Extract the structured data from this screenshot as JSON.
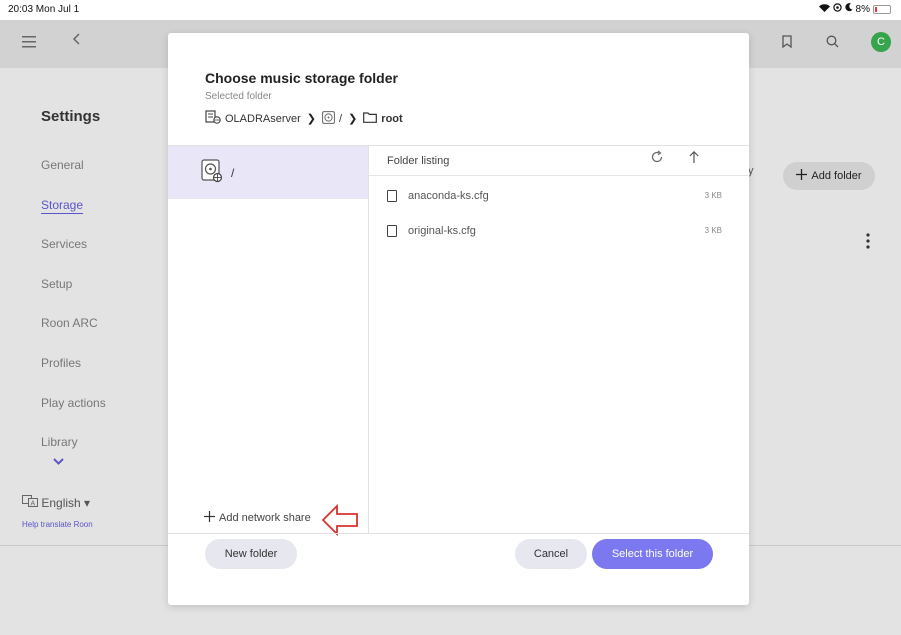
{
  "status_bar": {
    "time": "20:03  Mon Jul 1",
    "battery": "8%"
  },
  "background": {
    "settings_title": "Settings",
    "nav": [
      "General",
      "Storage",
      "Services",
      "Setup",
      "Roon ARC",
      "Profiles",
      "Play actions",
      "Library"
    ],
    "active_nav": "Storage",
    "language": "English",
    "help_link": "Help translate Roon",
    "add_folder": "Add folder",
    "partial_text": "y"
  },
  "dialog": {
    "title": "Choose music storage folder",
    "subtitle": "Selected folder",
    "breadcrumb": {
      "server": "OLADRAserver",
      "drive": "/",
      "folder": "root"
    },
    "drives": [
      {
        "label": "/"
      }
    ],
    "listing_label": "Folder listing",
    "files": [
      {
        "name": "anaconda-ks.cfg",
        "size": "3 KB"
      },
      {
        "name": "original-ks.cfg",
        "size": "3 KB"
      }
    ],
    "add_network_share": "Add network share",
    "buttons": {
      "new_folder": "New folder",
      "cancel": "Cancel",
      "select": "Select this folder"
    }
  },
  "colors": {
    "accent": "#7b78f0",
    "selected_row": "#e8e6f7",
    "annotation_arrow": "#d9312b"
  }
}
